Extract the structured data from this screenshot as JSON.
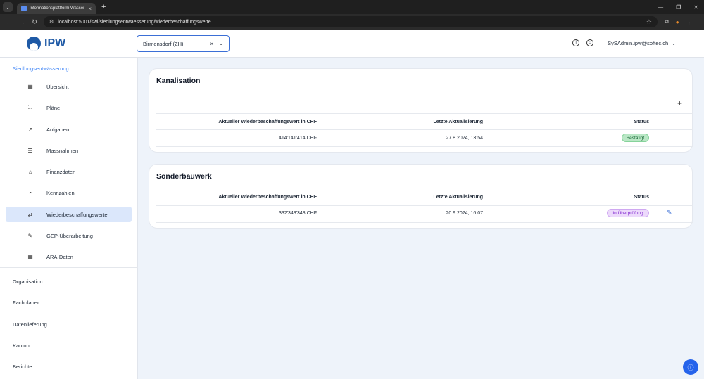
{
  "browser": {
    "tab_title": "Informationsplattform Wasser",
    "tab_close": "×",
    "new_tab": "+",
    "url": "localhost:5001/swl/siedlungsentwaesserung/wiederbeschaffungswerte"
  },
  "header": {
    "logo_text": "IPW",
    "commune": "Birmensdorf (ZH)",
    "clear": "×",
    "chevron": "⌄",
    "user": "SySAdmin.ipw@softec.ch"
  },
  "sidebar": {
    "section": "Siedlungsentwässerung",
    "items": [
      {
        "label": "Übersicht",
        "icon": "▦"
      },
      {
        "label": "Pläne",
        "icon": "⛶"
      },
      {
        "label": "Aufgaben",
        "icon": "↗"
      },
      {
        "label": "Massnahmen",
        "icon": "☰"
      },
      {
        "label": "Finanzdaten",
        "icon": "⌂"
      },
      {
        "label": "Kennzahlen",
        "icon": "◔"
      },
      {
        "label": "Wiederbeschaffungswerte",
        "icon": "⇄"
      },
      {
        "label": "GEP-Überarbeitung",
        "icon": "✎"
      },
      {
        "label": "ARA-Daten",
        "icon": "▦"
      }
    ],
    "top_items": [
      "Organisation",
      "Fachplaner",
      "Datenlieferung",
      "Kanton",
      "Berichte"
    ]
  },
  "cards": {
    "kanalisation": {
      "title": "Kanalisation",
      "col_value": "Aktueller Wiederbeschaffungswert in CHF",
      "col_updated": "Letzte Aktualisierung",
      "col_status": "Status",
      "value": "414'141'414 CHF",
      "updated": "27.8.2024, 13:54",
      "status": "Bestätigt"
    },
    "sonderbauwerk": {
      "title": "Sonderbauwerk",
      "col_value": "Aktueller Wiederbeschaffungswert in CHF",
      "col_updated": "Letzte Aktualisierung",
      "col_status": "Status",
      "value": "332'343'343 CHF",
      "updated": "20.9.2024, 16:07",
      "status": "In Überprüfung"
    }
  },
  "colors": {
    "primary": "#1f5aa6",
    "active_nav_bg": "#dbe7fb",
    "confirmed_badge": "#b9e7c5",
    "review_badge": "#ecd9fb"
  }
}
